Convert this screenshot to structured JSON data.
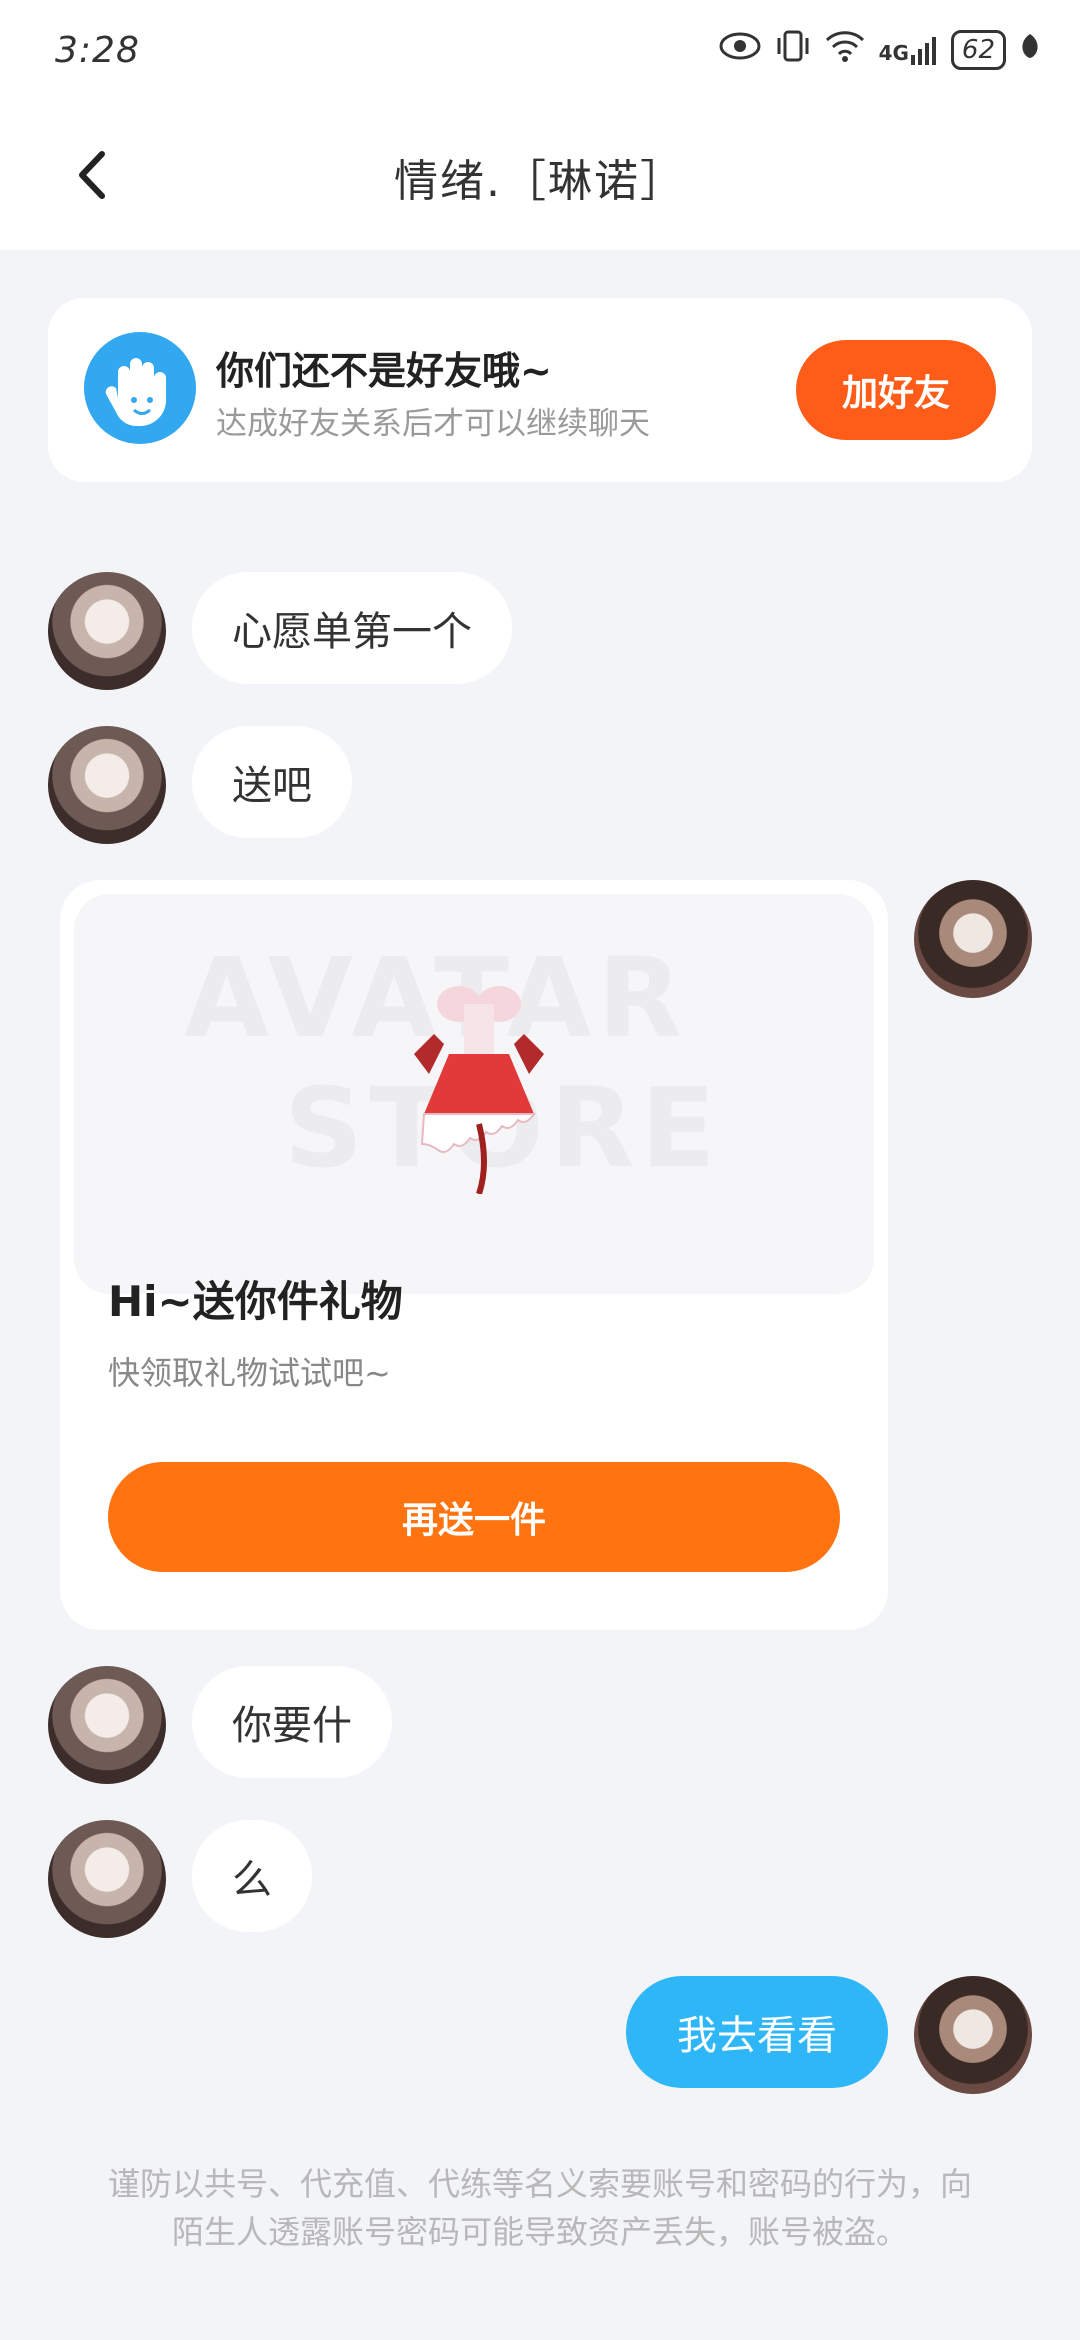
{
  "status_bar": {
    "time": "3:28",
    "signal_label": "4G",
    "battery": "62"
  },
  "header": {
    "title": "情绪.［琳诺］"
  },
  "friend_notice": {
    "title": "你们还不是好友哦~",
    "subtitle": "达成好友关系后才可以继续聊天",
    "add_button": "加好友"
  },
  "messages": [
    {
      "side": "left",
      "text": "心愿单第一个"
    },
    {
      "side": "left",
      "text": "送吧"
    },
    {
      "side": "right",
      "type": "gift"
    },
    {
      "side": "left",
      "text": "你要什"
    },
    {
      "side": "left",
      "text": "么"
    },
    {
      "side": "right",
      "text": "我去看看"
    }
  ],
  "gift_card": {
    "watermark_line1": "AVATAR",
    "watermark_line2": "STORE",
    "title": "Hi~送你件礼物",
    "subtitle": "快领取礼物试试吧~",
    "button": "再送一件"
  },
  "footer": {
    "warning": "谨防以共号、代充值、代练等名义索要账号和密码的行为，向陌生人透露账号密码可能导致资产丢失，账号被盗。"
  }
}
